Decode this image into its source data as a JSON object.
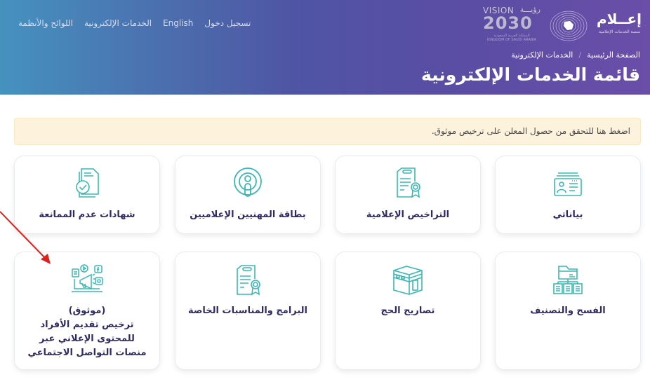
{
  "header": {
    "nav": [
      {
        "label": "اللوائح والأنظمة"
      },
      {
        "label": "الخدمات الإلكترونية"
      },
      {
        "label": "English"
      },
      {
        "label": "تسجيل دخول"
      }
    ],
    "logo_ilam": {
      "title": "إعــلام",
      "subtitle": "منصة الخدمات الإعلامية"
    },
    "logo_vision": {
      "line1": "VISION",
      "line1_ar": "رؤيـــة",
      "year": "2030",
      "caption_ar": "المملكة العربية السعودية",
      "caption_en": "KINGDOM OF SAUDI ARABIA"
    },
    "breadcrumb": [
      {
        "label": "الصفحة الرئيسية"
      },
      {
        "label": "الخدمات الإلكترونية"
      }
    ],
    "breadcrumb_separator": "/",
    "title": "قائمة الخدمات الإلكترونية"
  },
  "alert": {
    "text": "اضغط هنا للتحقق من حصول المعلن على ترخيص موثوق."
  },
  "services": [
    {
      "label": "بياناتي",
      "icon": "id-card-icon"
    },
    {
      "label": "التراخيص الإعلامية",
      "icon": "certificate-icon"
    },
    {
      "label": "بطاقة المهنيين الإعلاميين",
      "icon": "podcast-icon"
    },
    {
      "label": "شهادات عدم الممانعة",
      "icon": "document-check-icon"
    },
    {
      "label": "الفسح والتصنيف",
      "icon": "folder-tree-icon"
    },
    {
      "label": "تصاريح الحج",
      "icon": "kaaba-icon"
    },
    {
      "label": "البرامج والمناسبات الخاصة",
      "icon": "certificate-icon"
    },
    {
      "label": "(موثوق)\nترخيص تقديم الأفراد\nللمحتوى الإعلاني عبر\nمنصات التواصل الاجتماعي",
      "icon": "social-media-megaphone-icon"
    }
  ],
  "colors": {
    "accent_teal": "#3bb8b4",
    "title_navy": "#2e2a63",
    "alert_bg": "#fdf2dc",
    "annotation_arrow": "#e0201b"
  }
}
